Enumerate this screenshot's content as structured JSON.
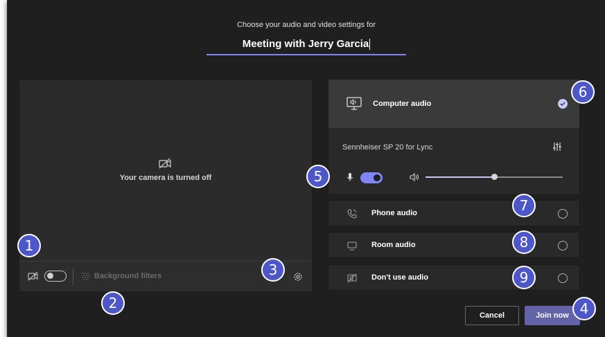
{
  "header": {
    "subtitle": "Choose your audio and video settings for",
    "meeting_name": "Meeting with Jerry Garcia"
  },
  "video": {
    "camera_status": "Your camera is turned off",
    "camera_toggle": "off",
    "background_filters_label": "Background filters"
  },
  "audio": {
    "computer_audio_label": "Computer audio",
    "computer_audio_selected": true,
    "device_name": "Sennheiser SP 20 for Lync",
    "mic_toggle": "on",
    "volume_level": 0.5,
    "options": [
      {
        "label": "Phone audio",
        "icon": "phone-icon",
        "selected": false
      },
      {
        "label": "Room audio",
        "icon": "monitor-icon",
        "selected": false
      },
      {
        "label": "Don't use audio",
        "icon": "speaker-off-icon",
        "selected": false
      }
    ]
  },
  "buttons": {
    "cancel": "Cancel",
    "join": "Join now"
  },
  "callouts": [
    "1",
    "2",
    "3",
    "4",
    "5",
    "6",
    "7",
    "8",
    "9"
  ],
  "colors": {
    "background": "#1f1f1f",
    "accent": "#7f85f5",
    "join_button": "#6264a7",
    "callout": "#4e57c8"
  }
}
